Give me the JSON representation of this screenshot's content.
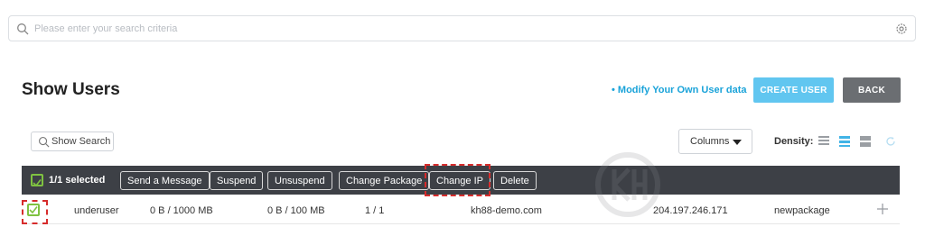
{
  "search": {
    "placeholder": "Please enter your search criteria"
  },
  "header": {
    "title": "Show Users",
    "modify_link": "• Modify Your Own User data",
    "create_label": "CREATE USER",
    "back_label": "BACK"
  },
  "toolbar": {
    "show_search_label": "Show Search",
    "columns_label": "Columns",
    "density_label": "Density:"
  },
  "action_bar": {
    "selected_text": "1/1 selected",
    "buttons": [
      "Send a Message",
      "Suspend",
      "Unsuspend",
      "Change Package",
      "Change IP",
      "Delete"
    ]
  },
  "rows": [
    {
      "username": "underuser",
      "bandwidth": "0 B / 1000 MB",
      "disk": "0 B / 100 MB",
      "ratio": "1 / 1",
      "domain": "kh88-demo.com",
      "ip": "204.197.246.171",
      "package": "newpackage"
    }
  ],
  "colors": {
    "accent": "#61c6f0",
    "link": "#1aa3d9",
    "back": "#6b6e72",
    "bar": "#3d4046",
    "check": "#7fc241",
    "highlight": "#d72c2c"
  },
  "icons": [
    "search-icon",
    "gear-icon",
    "caret-down-icon",
    "density-compact-icon",
    "density-normal-icon",
    "density-wide-icon",
    "refresh-icon",
    "checkbox-icon",
    "plus-icon"
  ]
}
